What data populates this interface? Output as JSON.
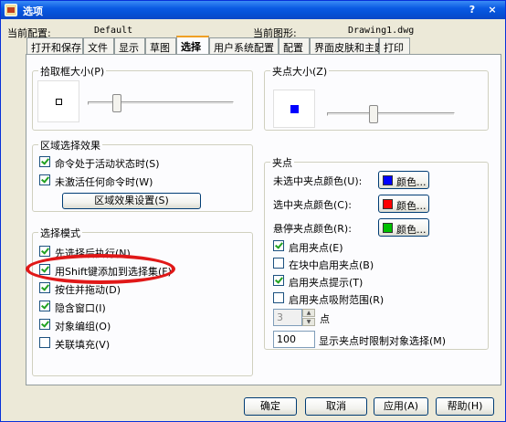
{
  "window": {
    "title": "选项",
    "help_glyph": "?",
    "close_glyph": "×"
  },
  "info": {
    "profile_label": "当前配置:",
    "profile_value": "Default",
    "drawing_label": "当前图形:",
    "drawing_value": "Drawing1.dwg"
  },
  "tabs": [
    {
      "label": "打开和保存"
    },
    {
      "label": "文件"
    },
    {
      "label": "显示"
    },
    {
      "label": "草图"
    },
    {
      "label": "选择",
      "active": true
    },
    {
      "label": "用户系统配置"
    },
    {
      "label": "配置"
    },
    {
      "label": "界面皮肤和主题"
    },
    {
      "label": "打印"
    }
  ],
  "pickbox": {
    "title": "拾取框大小(P)",
    "slider_fraction": 0.18
  },
  "grip_size": {
    "title": "夹点大小(Z)",
    "slider_fraction": 0.35
  },
  "area_selection": {
    "title": "区域选择效果",
    "items": [
      {
        "label": "命令处于活动状态时(S)",
        "checked": true
      },
      {
        "label": "未激活任何命令时(W)",
        "checked": true
      }
    ],
    "settings_button": "区域效果设置(S)"
  },
  "selection_modes": {
    "title": "选择模式",
    "items": [
      {
        "label": "先选择后执行(N)",
        "checked": true
      },
      {
        "label": "用Shift键添加到选择集(F)",
        "checked": true
      },
      {
        "label": "按住并拖动(D)",
        "checked": true
      },
      {
        "label": "隐含窗口(I)",
        "checked": true
      },
      {
        "label": "对象编组(O)",
        "checked": true
      },
      {
        "label": "关联填充(V)",
        "checked": false
      }
    ]
  },
  "grips": {
    "title": "夹点",
    "colors": [
      {
        "label": "未选中夹点颜色(U):",
        "button": "颜色...",
        "color": "#0000ff"
      },
      {
        "label": "选中夹点颜色(C):",
        "button": "颜色...",
        "color": "#ff0000"
      },
      {
        "label": "悬停夹点颜色(R):",
        "button": "颜色...",
        "color": "#00c000"
      }
    ],
    "options": [
      {
        "label": "启用夹点(E)",
        "checked": true
      },
      {
        "label": "在块中启用夹点(B)",
        "checked": false
      },
      {
        "label": "启用夹点提示(T)",
        "checked": true
      },
      {
        "label": "启用夹点吸附范围(R)",
        "checked": false
      }
    ],
    "point_value": "3",
    "point_label": "点",
    "limit_value": "100",
    "limit_label": "显示夹点时限制对象选择(M)"
  },
  "buttons": {
    "ok": "确定",
    "cancel": "取消",
    "apply": "应用(A)",
    "help": "帮助(H)"
  },
  "colors": {
    "titlebar": "#0a5ae3",
    "highlight": "#e01818",
    "tab_accent": "#f0a024"
  }
}
